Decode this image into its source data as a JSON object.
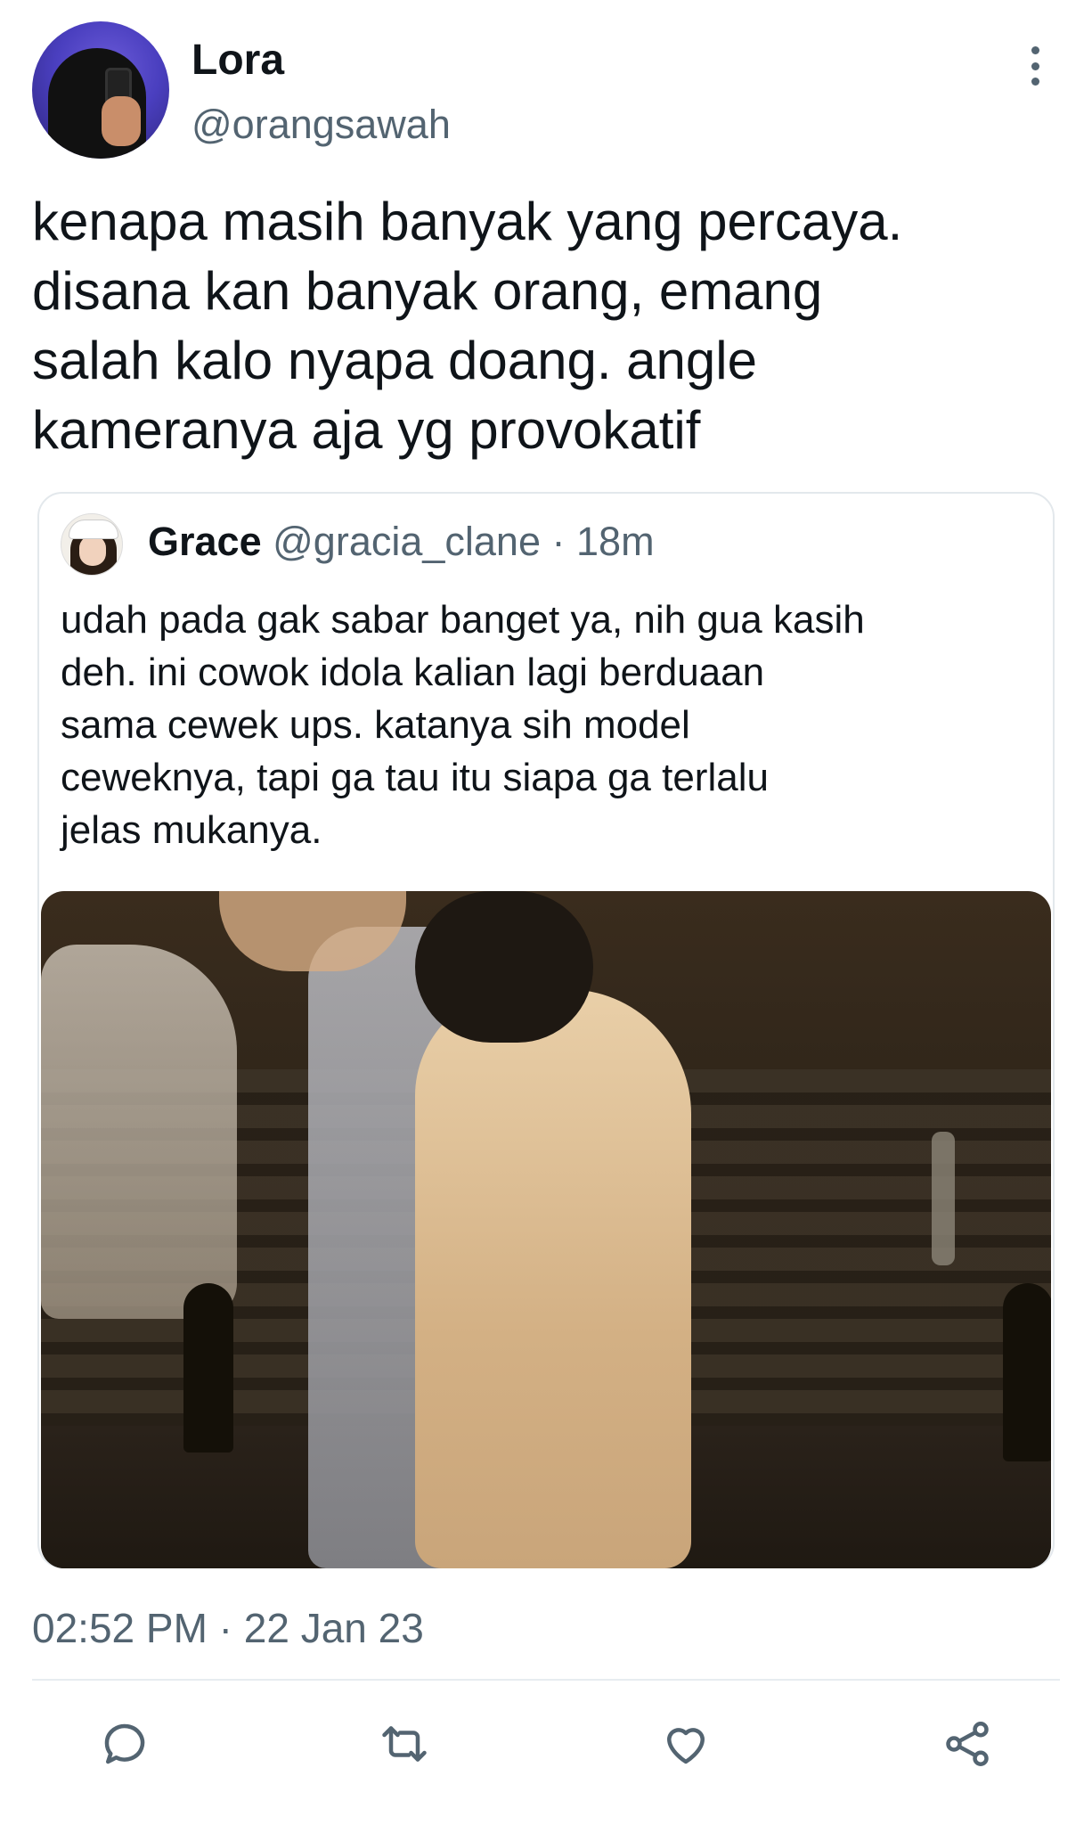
{
  "tweet": {
    "author": {
      "display_name": "Lora",
      "handle": "@orangsawah"
    },
    "text": "kenapa masih banyak yang percaya.\ndisana kan banyak orang, emang\nsalah kalo nyapa doang. angle\nkameranya aja yg provokatif",
    "timestamp": "02:52 PM · 22 Jan 23"
  },
  "quote": {
    "display_name": "Grace",
    "handle": "@gracia_clane",
    "separator": "·",
    "time": "18m",
    "text": "udah pada gak sabar banget ya, nih gua kasih\ndeh. ini cowok idola kalian lagi berduaan\nsama cewek ups. katanya sih model\nceweknya, tapi ga tau itu siapa ga terlalu\njelas mukanya."
  },
  "actions": [
    {
      "icon": "reply-icon"
    },
    {
      "icon": "retweet-icon"
    },
    {
      "icon": "heart-icon"
    },
    {
      "icon": "share-icon"
    }
  ],
  "colors": {
    "text_primary": "#0f1419",
    "text_secondary": "#536471",
    "border": "#e3e8ec"
  }
}
